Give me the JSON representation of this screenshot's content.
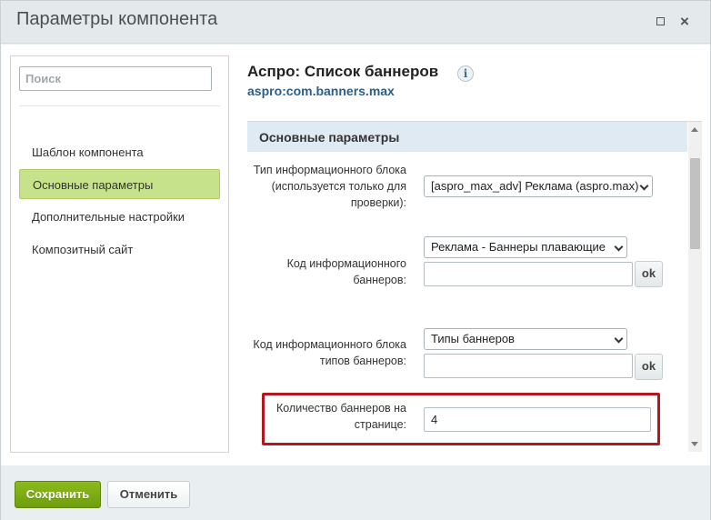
{
  "window": {
    "title": "Параметры компонента",
    "maximize_icon": "maximize-icon",
    "close_icon": "close-icon",
    "close_glyph": "×"
  },
  "sidebar": {
    "search_placeholder": "Поиск",
    "items": [
      {
        "label": "Шаблон компонента",
        "active": false
      },
      {
        "label": "Основные параметры",
        "active": true
      },
      {
        "label": "Дополнительные настройки",
        "active": false
      },
      {
        "label": "Композитный сайт",
        "active": false
      }
    ]
  },
  "component": {
    "title": "Аспро: Список баннеров",
    "info_glyph": "i",
    "code": "aspro:com.banners.max"
  },
  "section": {
    "title": "Основные параметры"
  },
  "params": {
    "iblock_type": {
      "label": "Тип информационного блока (используется только для проверки):",
      "selected": "[aspro_max_adv] Реклама (aspro.max)"
    },
    "iblock_code": {
      "label": "Код информационного баннеров:",
      "selected": "Реклама - Баннеры плавающие",
      "input_value": "",
      "ok_label": "ok"
    },
    "types_iblock_code": {
      "label": "Код информационного блока типов баннеров:",
      "selected": "Типы баннеров",
      "input_value": "",
      "ok_label": "ok"
    },
    "banners_count": {
      "label": "Количество баннеров на странице:",
      "value": "4"
    }
  },
  "footer": {
    "save_label": "Сохранить",
    "cancel_label": "Отменить"
  },
  "colors": {
    "active_nav": "#c6e28a",
    "save_button": "#7aab14",
    "highlight_border": "#b3181e",
    "section_header": "#e0eaf2"
  }
}
